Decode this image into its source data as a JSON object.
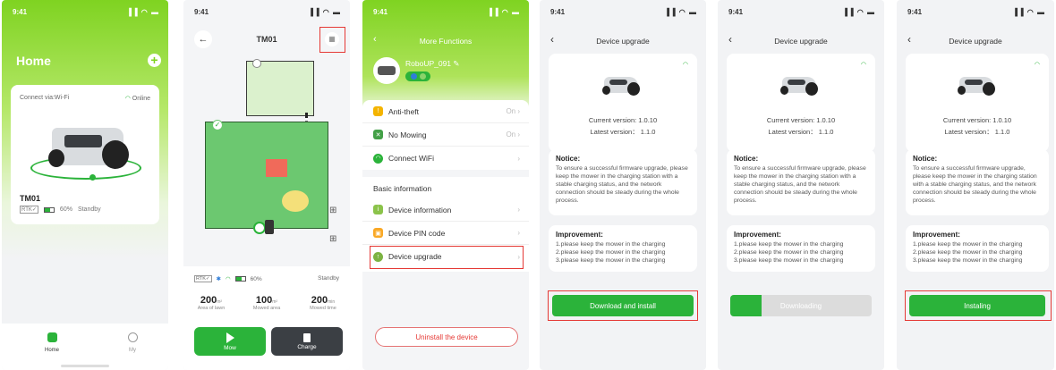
{
  "status_time": "9:41",
  "status_icons": "▐▐ ◠ ▬",
  "screen1": {
    "title": "Home",
    "add_icon": "+",
    "connect_label": "Connect via:Wi-Fi",
    "online_label": "Online",
    "device_name": "TM01",
    "rtk_label": "RTK✓",
    "battery_label": "60%",
    "state_label": "Standby",
    "tabs": [
      {
        "label": "Home"
      },
      {
        "label": "My"
      }
    ]
  },
  "screen2": {
    "title": "TM01",
    "rtk_label": "RTK✓",
    "battery_label": "60%",
    "state_label": "Standby",
    "stats": [
      {
        "value": "200",
        "unit": "m²",
        "label": "Area of lawn"
      },
      {
        "value": "100",
        "unit": "m²",
        "label": "Mowed area"
      },
      {
        "value": "200",
        "unit": "min",
        "label": "Mowed time"
      }
    ],
    "mow_label": "Mow",
    "charge_label": "Charge",
    "colors": {
      "zone": "#6cc870",
      "obstacle": "#f06a5a",
      "yellow": "#f4e07a"
    }
  },
  "screen3": {
    "title": "More Functions",
    "device_name": "RoboUP_091",
    "items_top": [
      {
        "label": "Anti-theft",
        "value": "On"
      },
      {
        "label": "No Mowing",
        "value": "On"
      },
      {
        "label": "Connect WiFi",
        "value": ""
      }
    ],
    "section_title": "Basic information",
    "items_basic": [
      {
        "label": "Device information"
      },
      {
        "label": "Device PIN code"
      },
      {
        "label": "Device upgrade"
      }
    ],
    "uninstall_label": "Uninstall the device"
  },
  "upgrade": {
    "title": "Device upgrade",
    "current_version": "Current version: 1.0.10",
    "latest_version": "Latest version： 1.1.0",
    "notice_title": "Notice:",
    "notice_text": "To ensure a successful firmware upgrade, please keep the mower in the charging station with a stable charging status, and the network connection should be steady during the whole process.",
    "improvement_title": "Improvement:",
    "improvements": [
      "1.please keep the mower in the charging",
      "2.please keep the mower in the charging",
      "3.please keep the mower in the charging"
    ],
    "download_label": "Download and install",
    "downloading_label": "Downloading",
    "downloading_progress": 0.22,
    "installing_label": "Instaling"
  },
  "colors": {
    "accent": "#2bb33a",
    "grad": "#7fd321",
    "highlight": "#e53935"
  }
}
